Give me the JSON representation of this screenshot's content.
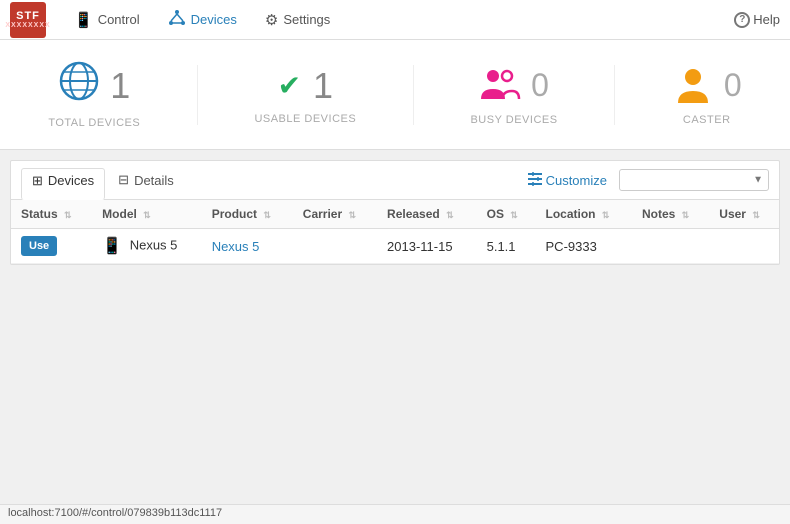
{
  "app": {
    "logo_top": "STF",
    "logo_bottom": "XXXXXXXX"
  },
  "nav": {
    "items": [
      {
        "id": "control",
        "label": "Control",
        "icon": "📱",
        "active": false
      },
      {
        "id": "devices",
        "label": "Devices",
        "icon": "🔗",
        "active": true
      },
      {
        "id": "settings",
        "label": "Settings",
        "icon": "⚙",
        "active": false
      }
    ],
    "help_label": "Help"
  },
  "stats": [
    {
      "id": "total",
      "icon": "globe",
      "number": "1",
      "label": "TOTAL DEVICES"
    },
    {
      "id": "usable",
      "icon": "check",
      "number": "1",
      "label": "USABLE DEVICES"
    },
    {
      "id": "busy",
      "icon": "busy",
      "number": "0",
      "label": "BUSY DEVICES"
    },
    {
      "id": "caster",
      "icon": "caster",
      "number": "0",
      "label": "CASTER"
    }
  ],
  "tabs": [
    {
      "id": "devices",
      "label": "Devices",
      "active": true
    },
    {
      "id": "details",
      "label": "Details",
      "active": false
    }
  ],
  "customize_label": "Customize",
  "search_placeholder": "",
  "table": {
    "columns": [
      {
        "id": "status",
        "label": "Status"
      },
      {
        "id": "model",
        "label": "Model"
      },
      {
        "id": "product",
        "label": "Product"
      },
      {
        "id": "carrier",
        "label": "Carrier"
      },
      {
        "id": "released",
        "label": "Released"
      },
      {
        "id": "os",
        "label": "OS"
      },
      {
        "id": "location",
        "label": "Location"
      },
      {
        "id": "notes",
        "label": "Notes"
      },
      {
        "id": "user",
        "label": "User"
      }
    ],
    "rows": [
      {
        "status_btn": "Use",
        "model": "Nexus 5",
        "product": "Nexus 5",
        "carrier": "",
        "released": "2013-11-15",
        "os": "5.1.1",
        "location": "PC-9333",
        "notes": "",
        "user": ""
      }
    ]
  },
  "statusbar": {
    "url": "localhost:7100/#/control/079839b113dc1117"
  }
}
